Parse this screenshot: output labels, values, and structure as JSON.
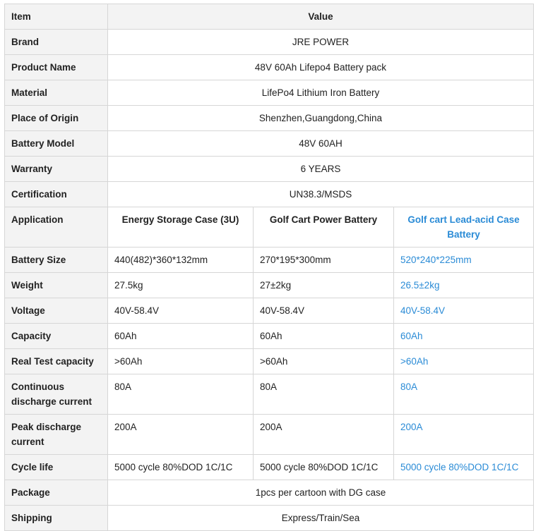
{
  "accent_color": "#2a8bd6",
  "header": {
    "item": "Item",
    "value": "Value"
  },
  "single_rows": [
    {
      "label": "Brand",
      "value": "JRE POWER"
    },
    {
      "label": "Product Name",
      "value": "48V 60Ah Lifepo4 Battery pack"
    },
    {
      "label": "Material",
      "value": "LifePo4 Lithium Iron Battery"
    },
    {
      "label": "Place of Origin",
      "value": "Shenzhen,Guangdong,China"
    },
    {
      "label": "Battery Model",
      "value": "48V 60AH"
    },
    {
      "label": "Warranty",
      "value": "6 YEARS"
    },
    {
      "label": "Certification",
      "value": "UN38.3/MSDS"
    }
  ],
  "application": {
    "label": "Application",
    "cols": [
      "Energy Storage Case (3U)",
      "Golf Cart Power Battery",
      "Golf cart Lead-acid Case Battery"
    ]
  },
  "multi_rows": [
    {
      "label": "Battery Size",
      "values": [
        "440(482)*360*132mm",
        "270*195*300mm",
        "520*240*225mm"
      ]
    },
    {
      "label": "Weight",
      "values": [
        "27.5kg",
        "27±2kg",
        "26.5±2kg"
      ]
    },
    {
      "label": "Voltage",
      "values": [
        "40V-58.4V",
        "40V-58.4V",
        "40V-58.4V"
      ]
    },
    {
      "label": "Capacity",
      "values": [
        "60Ah",
        "60Ah",
        "60Ah"
      ]
    },
    {
      "label": "Real Test capacity",
      "values": [
        ">60Ah",
        ">60Ah",
        ">60Ah"
      ]
    },
    {
      "label": "Continuous discharge current",
      "values": [
        "80A",
        "80A",
        "80A"
      ]
    },
    {
      "label": "Peak discharge current",
      "values": [
        "200A",
        "200A",
        "200A"
      ]
    },
    {
      "label": "Cycle life",
      "values": [
        "5000 cycle 80%DOD 1C/1C",
        "5000 cycle 80%DOD 1C/1C",
        "5000 cycle 80%DOD 1C/1C"
      ]
    }
  ],
  "footer_rows": [
    {
      "label": "Package",
      "value": "1pcs per cartoon with DG case"
    },
    {
      "label": "Shipping",
      "value": "Express/Train/Sea"
    }
  ]
}
